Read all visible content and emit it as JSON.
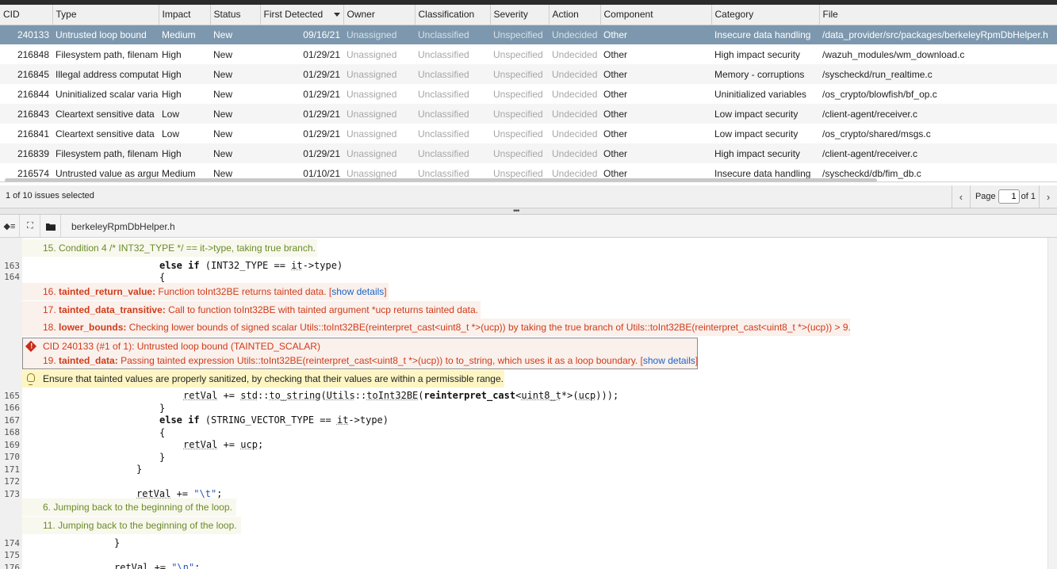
{
  "issues": {
    "columns": [
      "CID",
      "Type",
      "Impact",
      "Status",
      "First Detected",
      "Owner",
      "Classification",
      "Severity",
      "Action",
      "Component",
      "Category",
      "File"
    ],
    "rows": [
      {
        "cid": "240133",
        "type": "Untrusted loop bound",
        "impact": "Medium",
        "status": "New",
        "first_detected": "09/16/21",
        "owner": "Unassigned",
        "classification": "Unclassified",
        "severity": "Unspecified",
        "action": "Undecided",
        "component": "Other",
        "category": "Insecure data handling",
        "file": "/data_provider/src/packages/berkeleyRpmDbHelper.h"
      },
      {
        "cid": "216848",
        "type": "Filesystem path, filename",
        "impact": "High",
        "status": "New",
        "first_detected": "01/29/21",
        "owner": "Unassigned",
        "classification": "Unclassified",
        "severity": "Unspecified",
        "action": "Undecided",
        "component": "Other",
        "category": "High impact security",
        "file": "/wazuh_modules/wm_download.c"
      },
      {
        "cid": "216845",
        "type": "Illegal address computation",
        "impact": "High",
        "status": "New",
        "first_detected": "01/29/21",
        "owner": "Unassigned",
        "classification": "Unclassified",
        "severity": "Unspecified",
        "action": "Undecided",
        "component": "Other",
        "category": "Memory - corruptions",
        "file": "/syscheckd/run_realtime.c"
      },
      {
        "cid": "216844",
        "type": "Uninitialized scalar variable",
        "impact": "High",
        "status": "New",
        "first_detected": "01/29/21",
        "owner": "Unassigned",
        "classification": "Unclassified",
        "severity": "Unspecified",
        "action": "Undecided",
        "component": "Other",
        "category": "Uninitialized variables",
        "file": "/os_crypto/blowfish/bf_op.c"
      },
      {
        "cid": "216843",
        "type": "Cleartext sensitive data",
        "impact": "Low",
        "status": "New",
        "first_detected": "01/29/21",
        "owner": "Unassigned",
        "classification": "Unclassified",
        "severity": "Unspecified",
        "action": "Undecided",
        "component": "Other",
        "category": "Low impact security",
        "file": "/client-agent/receiver.c"
      },
      {
        "cid": "216841",
        "type": "Cleartext sensitive data",
        "impact": "Low",
        "status": "New",
        "first_detected": "01/29/21",
        "owner": "Unassigned",
        "classification": "Unclassified",
        "severity": "Unspecified",
        "action": "Undecided",
        "component": "Other",
        "category": "Low impact security",
        "file": "/os_crypto/shared/msgs.c"
      },
      {
        "cid": "216839",
        "type": "Filesystem path, filename",
        "impact": "High",
        "status": "New",
        "first_detected": "01/29/21",
        "owner": "Unassigned",
        "classification": "Unclassified",
        "severity": "Unspecified",
        "action": "Undecided",
        "component": "Other",
        "category": "High impact security",
        "file": "/client-agent/receiver.c"
      },
      {
        "cid": "216574",
        "type": "Untrusted value as argument",
        "impact": "Medium",
        "status": "New",
        "first_detected": "01/10/21",
        "owner": "Unassigned",
        "classification": "Unclassified",
        "severity": "Unspecified",
        "action": "Undecided",
        "component": "Other",
        "category": "Insecure data handling",
        "file": "/syscheckd/db/fim_db.c"
      }
    ]
  },
  "status": {
    "selection": "1 of 10 issues selected",
    "page_label": "Page",
    "page_value": "1",
    "of_label": "of 1",
    "prev": "‹",
    "next": "›"
  },
  "viewer": {
    "filename": "berkeleyRpmDbHelper.h",
    "toolbar": {
      "outline": "◆≡",
      "expand": "⛶"
    }
  },
  "source": {
    "line_numbers": [
      "163",
      "164",
      "165",
      "166",
      "167",
      "168",
      "169",
      "170",
      "171",
      "172",
      "173",
      "174",
      "175",
      "176"
    ],
    "events": {
      "e15": "15. Condition 4 /* INT32_TYPE */ == it->type, taking true branch.",
      "e16_num": "16.",
      "e16_tag": "tainted_return_value:",
      "e16_text": "Function toInt32BE returns tainted data. [",
      "e16_link": "show details",
      "e16_end": "]",
      "e17_num": "17.",
      "e17_tag": "tainted_data_transitive:",
      "e17_text": "Call to function toInt32BE with tainted argument *ucp returns tainted data.",
      "e18_num": "18.",
      "e18_tag": "lower_bounds:",
      "e18_text": "Checking lower bounds of signed scalar Utils::toInt32BE(reinterpret_cast<uint8_t *>(ucp)) by taking the true branch of Utils::toInt32BE(reinterpret_cast<uint8_t *>(ucp)) > 9.",
      "main_header": "CID 240133 (#1 of 1): Untrusted loop bound (TAINTED_SCALAR)",
      "e19_num": "19.",
      "e19_tag": "tainted_data:",
      "e19_text": "Passing tainted expression Utils::toInt32BE(reinterpret_cast<uint8_t *>(ucp)) to to_string, which uses it as a loop boundary. [",
      "e19_link": "show details",
      "e19_end": "]",
      "remediation": "Ensure that tainted values are properly sanitized, by checking that their values are within a permissible range.",
      "e6": "6. Jumping back to the beginning of the loop.",
      "e11": "11. Jumping back to the beginning of the loop."
    }
  }
}
